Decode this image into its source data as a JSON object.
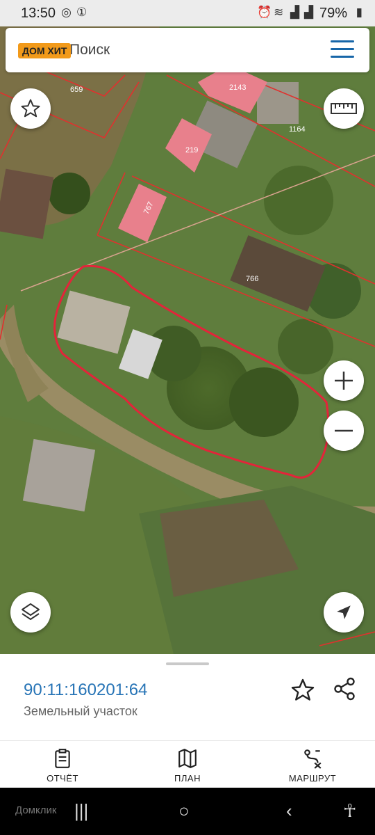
{
  "status_bar": {
    "time": "13:50",
    "battery": "79%",
    "icons": [
      "viber-icon",
      "notification-1-icon",
      "alarm-icon",
      "wifi-icon",
      "signal-icon",
      "signal-icon",
      "battery-icon"
    ]
  },
  "search": {
    "text": "Поиск",
    "logo_text": "ДОМ ХИТ"
  },
  "map": {
    "parcel_labels": [
      "659",
      "2143",
      "219",
      "1164",
      "767",
      "766"
    ],
    "controls": [
      "favorite-star-icon",
      "ruler-icon",
      "zoom-in-icon",
      "zoom-out-icon",
      "layers-icon",
      "locate-arrow-icon"
    ]
  },
  "sheet": {
    "cadastral_number": "90:11:160201:64",
    "object_type": "Земельный участок"
  },
  "tabs": [
    {
      "label": "ОТЧЁТ",
      "icon": "report-icon"
    },
    {
      "label": "ПЛАН",
      "icon": "map-plan-icon"
    },
    {
      "label": "МАРШРУТ",
      "icon": "route-icon"
    }
  ],
  "nav": {
    "brand": "Домклик"
  },
  "colors": {
    "accent": "#2774b6",
    "logo": "#f29a1a",
    "boundary": "#e0312e",
    "parcel_fill": "#e8808c"
  }
}
